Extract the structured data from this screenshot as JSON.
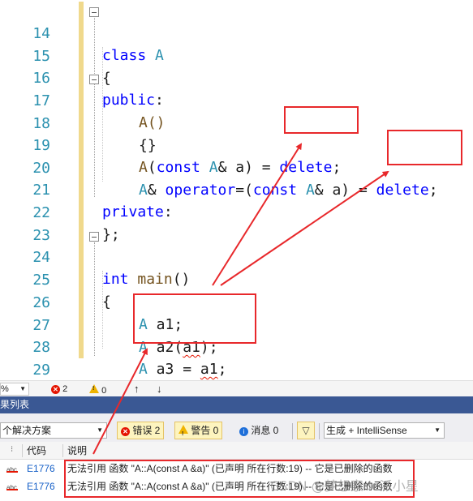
{
  "editor": {
    "lines": [
      {
        "num": "14"
      },
      {
        "num": "15"
      },
      {
        "num": "16"
      },
      {
        "num": "17"
      },
      {
        "num": "18"
      },
      {
        "num": "19"
      },
      {
        "num": "20"
      },
      {
        "num": "21"
      },
      {
        "num": "22"
      },
      {
        "num": "23"
      },
      {
        "num": "24"
      },
      {
        "num": "25"
      },
      {
        "num": "26"
      },
      {
        "num": "27"
      },
      {
        "num": "28"
      },
      {
        "num": "29"
      }
    ],
    "code": {
      "l14_kw": "class",
      "l14_name": " A",
      "l15": "{",
      "l16_kw": "public",
      "l16_colon": ":",
      "l17": "A()",
      "l18": "{}",
      "l19_fn": "A",
      "l19_a": "(",
      "l19_kw": "const",
      "l19_ty": " A",
      "l19_b": "& a) = ",
      "l19_del": "delete",
      "l19_c": ";",
      "l20_ty": "A",
      "l20_a": "& ",
      "l20_op": "operator",
      "l20_b": "=(",
      "l20_kw": "const",
      "l20_ty2": " A",
      "l20_c": "& a) = ",
      "l20_del": "delete",
      "l20_d": ";",
      "l21_kw": "private",
      "l21_colon": ":",
      "l22": "};",
      "l24_kw": "int",
      "l24_fn": " main",
      "l24_rest": "()",
      "l25": "{",
      "l26_ty": "A",
      "l26_rest": " a1;",
      "l27_ty": "A",
      "l27_a": " a2(",
      "l27_sq": "a1",
      "l27_b": ");",
      "l28_ty": "A",
      "l28_a": " a3 = ",
      "l28_sq": "a1",
      "l28_b": ";",
      "l29": "}"
    }
  },
  "status_strip": {
    "zoom": "%",
    "error_count": "2",
    "warning_count": "0",
    "up_arrow": "↑",
    "down_arrow": "↓"
  },
  "error_list": {
    "title": "果列表",
    "scope": "个解决方案",
    "errors_btn": "错误 2",
    "warnings_btn": "警告 0",
    "messages_btn": "消息 0",
    "build_select": "生成 + IntelliSense",
    "columns": {
      "code": "代码",
      "description": "说明"
    },
    "rows": [
      {
        "icon": "abc",
        "code": "E1776",
        "description": "无法引用 函数 \"A::A(const A &a)\" (已声明 所在行数:19) -- 它是已删除的函数"
      },
      {
        "icon": "abc",
        "code": "E1776",
        "description": "无法引用 函数 \"A::A(const A &a)\" (已声明 所在行数:19) -- 它是已删除的函数"
      }
    ],
    "watermark": "CSDN @梦想家de派小星"
  },
  "colors": {
    "keyword": "#0000ff",
    "type": "#2b91af",
    "line_number": "#2b91af",
    "annotation_red": "#e8282b",
    "panel_title_bg": "#3a5894"
  }
}
